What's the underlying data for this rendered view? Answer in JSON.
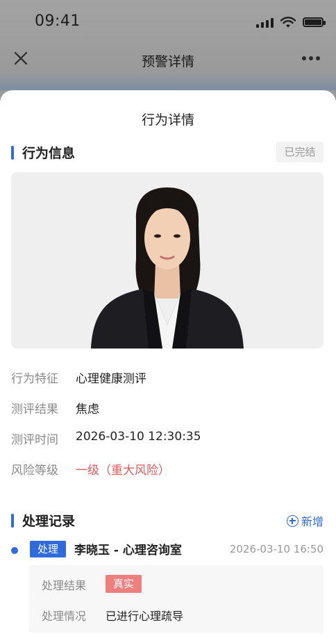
{
  "status_bar": {
    "time": "09:41"
  },
  "nav": {
    "title": "预警详情",
    "close_icon": "close-icon",
    "more_icon": "more-icon"
  },
  "sheet": {
    "title": "行为详情"
  },
  "behavior_section": {
    "title": "行为信息",
    "status_badge": "已完结",
    "fields": [
      {
        "key": "行为特征",
        "value": "心理健康测评"
      },
      {
        "key": "测评结果",
        "value": "焦虑"
      },
      {
        "key": "测评时间",
        "value": "2026-03-10 12:30:35"
      },
      {
        "key": "风险等级",
        "value": "一级（重大风险）"
      }
    ]
  },
  "records_section": {
    "title": "处理记录",
    "add_label": "新增",
    "records": [
      {
        "tag": "处理",
        "name": "李晓玉 - 心理咨询室",
        "time": "2026-03-10  16:50",
        "result_label": "处理结果",
        "result_tag": "真实",
        "detail_label": "处理情况",
        "detail_value": "已进行心理疏导"
      }
    ]
  },
  "colors": {
    "accent": "#2f6bdc",
    "danger": "#e05b5b",
    "tag_real": "#ee7f7f"
  }
}
